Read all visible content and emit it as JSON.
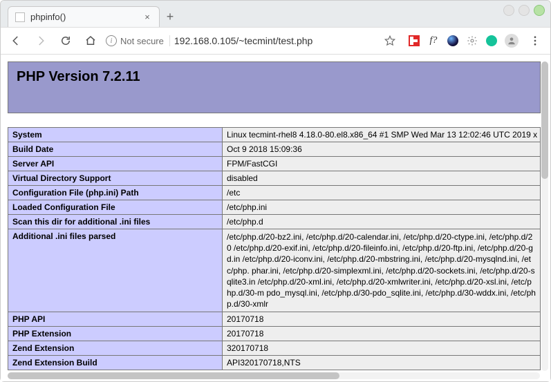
{
  "browser": {
    "tab_title": "phpinfo()",
    "not_secure_label": "Not secure",
    "url": "192.168.0.105/~tecmint/test.php"
  },
  "phpinfo": {
    "banner": "PHP Version 7.2.11",
    "rows": [
      {
        "k": "System",
        "v": "Linux tecmint-rhel8 4.18.0-80.el8.x86_64 #1 SMP Wed Mar 13 12:02:46 UTC 2019 x"
      },
      {
        "k": "Build Date",
        "v": "Oct 9 2018 15:09:36"
      },
      {
        "k": "Server API",
        "v": "FPM/FastCGI"
      },
      {
        "k": "Virtual Directory Support",
        "v": "disabled"
      },
      {
        "k": "Configuration File (php.ini) Path",
        "v": "/etc"
      },
      {
        "k": "Loaded Configuration File",
        "v": "/etc/php.ini"
      },
      {
        "k": "Scan this dir for additional .ini files",
        "v": "/etc/php.d"
      },
      {
        "k": "Additional .ini files parsed",
        "v": "/etc/php.d/20-bz2.ini, /etc/php.d/20-calendar.ini, /etc/php.d/20-ctype.ini, /etc/php.d/20 /etc/php.d/20-exif.ini, /etc/php.d/20-fileinfo.ini, /etc/php.d/20-ftp.ini, /etc/php.d/20-gd.in /etc/php.d/20-iconv.ini, /etc/php.d/20-mbstring.ini, /etc/php.d/20-mysqlnd.ini, /etc/php. phar.ini, /etc/php.d/20-simplexml.ini, /etc/php.d/20-sockets.ini, /etc/php.d/20-sqlite3.in /etc/php.d/20-xml.ini, /etc/php.d/20-xmlwriter.ini, /etc/php.d/20-xsl.ini, /etc/php.d/30-m pdo_mysql.ini, /etc/php.d/30-pdo_sqlite.ini, /etc/php.d/30-wddx.ini, /etc/php.d/30-xmlr",
        "wrap": true
      },
      {
        "k": "PHP API",
        "v": "20170718"
      },
      {
        "k": "PHP Extension",
        "v": "20170718"
      },
      {
        "k": "Zend Extension",
        "v": "320170718"
      },
      {
        "k": "Zend Extension Build",
        "v": "API320170718,NTS"
      }
    ]
  }
}
